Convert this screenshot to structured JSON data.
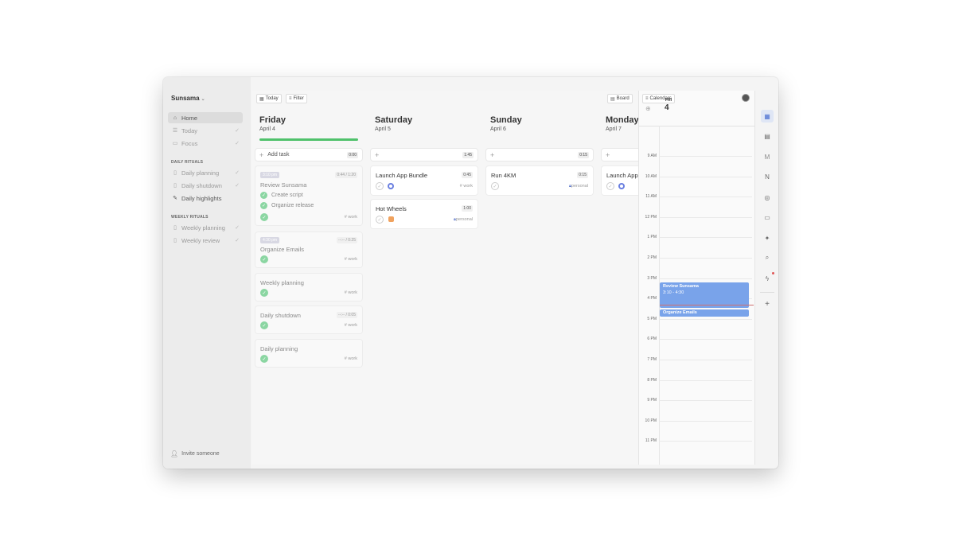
{
  "workspace": "Sunsama",
  "sidebar": {
    "items": [
      {
        "label": "Home",
        "icon": "home-icon"
      },
      {
        "label": "Today",
        "icon": "list-icon"
      },
      {
        "label": "Focus",
        "icon": "monitor-icon"
      }
    ],
    "daily_rituals_heading": "DAILY RITUALS",
    "daily": [
      {
        "label": "Daily planning"
      },
      {
        "label": "Daily shutdown"
      },
      {
        "label": "Daily highlights"
      }
    ],
    "weekly_rituals_heading": "WEEKLY RITUALS",
    "weekly": [
      {
        "label": "Weekly planning"
      },
      {
        "label": "Weekly review"
      }
    ],
    "invite": "Invite someone"
  },
  "toolbar": {
    "today": "Today",
    "filter": "Filter",
    "board": "Board",
    "calendars": "Calendars"
  },
  "days": [
    {
      "name": "Friday",
      "date": "April 4",
      "add_label": "Add task",
      "add_time": "0:00",
      "tasks": [
        {
          "stamp": "3:10 pm",
          "title": "Review Sunsama",
          "time": "0:44 / 1:20",
          "sub": [
            "Create script",
            "Organize release"
          ],
          "tag": "# work"
        },
        {
          "stamp": "4:30 pm",
          "title": "Organize Emails",
          "time": "--:-- / 0:25",
          "tag": "# work"
        },
        {
          "title": "Weekly planning",
          "tag": "# work"
        },
        {
          "title": "Daily shutdown",
          "time": "--:-- / 0:05",
          "tag": "# work"
        },
        {
          "title": "Daily planning",
          "tag": "# work"
        }
      ]
    },
    {
      "name": "Saturday",
      "date": "April 5",
      "add_time": "1:45",
      "tasks": [
        {
          "title": "Launch App Bundle",
          "time": "0:45",
          "tag": "# work"
        },
        {
          "title": "Hot Wheels",
          "time": "1:00",
          "tag": "personal"
        }
      ]
    },
    {
      "name": "Sunday",
      "date": "April 6",
      "add_time": "0:15",
      "tasks": [
        {
          "title": "Run 4KM",
          "time": "0:15",
          "tag": "personal"
        }
      ]
    },
    {
      "name": "Monday",
      "date": "April 7",
      "tasks": [
        {
          "title": "Launch App"
        }
      ]
    }
  ],
  "calendar": {
    "day_label": "FRI",
    "day_number": "4",
    "hours": [
      "9 AM",
      "10 AM",
      "11 AM",
      "12 PM",
      "1 PM",
      "2 PM",
      "3 PM",
      "4 PM",
      "5 PM",
      "6 PM",
      "7 PM",
      "8 PM",
      "9 PM",
      "10 PM",
      "11 PM"
    ],
    "events": [
      {
        "title": "Review Sunsama",
        "time": "3:10 - 4:30"
      },
      {
        "title": "Organize Emails"
      }
    ]
  },
  "rail_icons": [
    "calendar-icon",
    "notes-icon",
    "gmail-icon",
    "notion-icon",
    "target-icon",
    "archive-icon",
    "ai-icon",
    "search-icon",
    "bolt-icon",
    "add-icon"
  ],
  "colors": {
    "progress": "#4fc16b",
    "event": "#79a3ea",
    "check": "#8bd6a2"
  }
}
